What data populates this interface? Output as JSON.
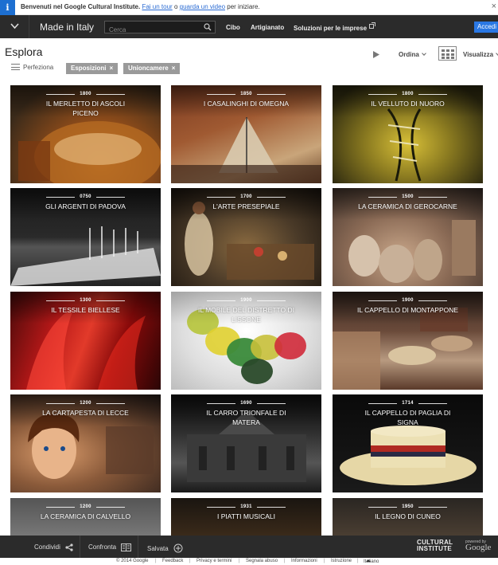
{
  "info_bar": {
    "welcome": "Benvenuti nel Google Cultural Institute.",
    "tour_link": "Fai un tour",
    "or_text": "o",
    "video_link": "guarda un video",
    "suffix": "per iniziare.",
    "close": "×"
  },
  "nav": {
    "title": "Made in Italy",
    "search_placeholder": "Cerca",
    "links": [
      "Cibo",
      "Artigianato",
      "Soluzioni per le imprese"
    ],
    "signin": "Accedi"
  },
  "toolbar": {
    "page_title": "Esplora",
    "refine_label": "Perfeziona",
    "filters": [
      "Esposizioni",
      "Unioncamere"
    ],
    "filter_remove": "×",
    "sort_label": "Ordina",
    "view_label": "Visualizza"
  },
  "tiles": [
    {
      "year": "1800",
      "title": "Il merletto di Ascoli Piceno",
      "bg": "merletto"
    },
    {
      "year": "1850",
      "title": "I casalinghi di Omegna",
      "bg": "casalinghi"
    },
    {
      "year": "1800",
      "title": "Il velluto di Nuoro",
      "bg": "velluto"
    },
    {
      "year": "0750",
      "title": "Gli argenti di Padova",
      "bg": "argenti"
    },
    {
      "year": "1700",
      "title": "L'arte presepiale",
      "bg": "presepiale"
    },
    {
      "year": "1500",
      "title": "La ceramica di Gerocarne",
      "bg": "ceramica"
    },
    {
      "year": "1300",
      "title": "Il tessile biellese",
      "bg": "tessile"
    },
    {
      "year": "1900",
      "title": "Il mobile del distretto di Lissone",
      "bg": "mobile"
    },
    {
      "year": "1900",
      "title": "Il cappello di Montappone",
      "bg": "cappello"
    },
    {
      "year": "1200",
      "title": "La cartapesta di Lecce",
      "bg": "cartapesta"
    },
    {
      "year": "1690",
      "title": "Il carro trionfale di Matera",
      "bg": "carro"
    },
    {
      "year": "1714",
      "title": "Il cappello di paglia di Signa",
      "bg": "paglia"
    },
    {
      "year": "1200",
      "title": "La ceramica di Calvello",
      "bg": "calvello"
    },
    {
      "year": "1931",
      "title": "I piatti musicali",
      "bg": "piatti"
    },
    {
      "year": "1950",
      "title": "Il legno di Cuneo",
      "bg": "legno"
    }
  ],
  "bottom_bar": {
    "share": "Condividi",
    "compare": "Confronta",
    "save": "Salvata",
    "logo_line1": "CULTURAL",
    "logo_line2": "INSTITUTE",
    "powered_by": "powered by",
    "google": "Google"
  },
  "footer": {
    "copyright": "© 2014 Google",
    "links": [
      "Feedback",
      "Privacy e termini",
      "Segnala abuso",
      "Informazioni",
      "Istruzione"
    ],
    "language": "Italiano"
  }
}
